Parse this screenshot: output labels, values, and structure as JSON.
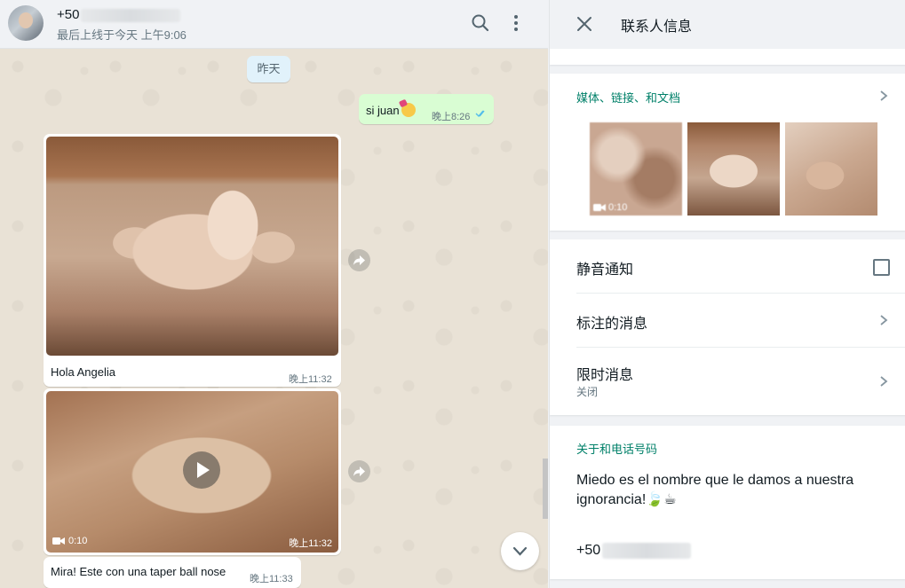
{
  "chat": {
    "header": {
      "name_prefix": "+50",
      "status": "最后上线于今天 上午9:06",
      "search_icon": "search-icon",
      "menu_icon": "more-vertical-icon"
    },
    "date_chip": "昨天",
    "messages": [
      {
        "type": "text",
        "direction": "out",
        "text": "si juan",
        "emoji": "partying-face-emoji",
        "time": "晚上8:26",
        "status_icon": "double-check-icon"
      },
      {
        "type": "image",
        "direction": "in",
        "caption": "Hola Angelia",
        "time": "晚上11:32"
      },
      {
        "type": "video",
        "direction": "in",
        "duration": "0:10",
        "time": "晚上11:32"
      },
      {
        "type": "text",
        "direction": "in",
        "text": "Mira!  Este con una taper ball nose",
        "time": "晚上11:33"
      }
    ],
    "scroll_down_icon": "chevron-down-icon",
    "forward_icon": "forward-icon"
  },
  "panel": {
    "title": "联系人信息",
    "close_icon": "close-icon",
    "media": {
      "title": "媒体、链接、和文档",
      "thumbs": [
        {
          "kind": "video",
          "duration": "0:10"
        },
        {
          "kind": "image"
        },
        {
          "kind": "image"
        }
      ]
    },
    "mute": {
      "label": "静音通知",
      "checked": false
    },
    "starred": {
      "label": "标注的消息"
    },
    "disappearing": {
      "label": "限时消息",
      "value": "关闭"
    },
    "about": {
      "title": "关于和电话号码",
      "text": "Miedo es el nombre que le damos a nuestra ignorancia!",
      "emoji": "🍃☕",
      "phone_prefix": "+50"
    }
  },
  "colors": {
    "accent": "#008069",
    "out_bubble": "#d9fdd3",
    "tick_blue": "#53bdeb"
  }
}
